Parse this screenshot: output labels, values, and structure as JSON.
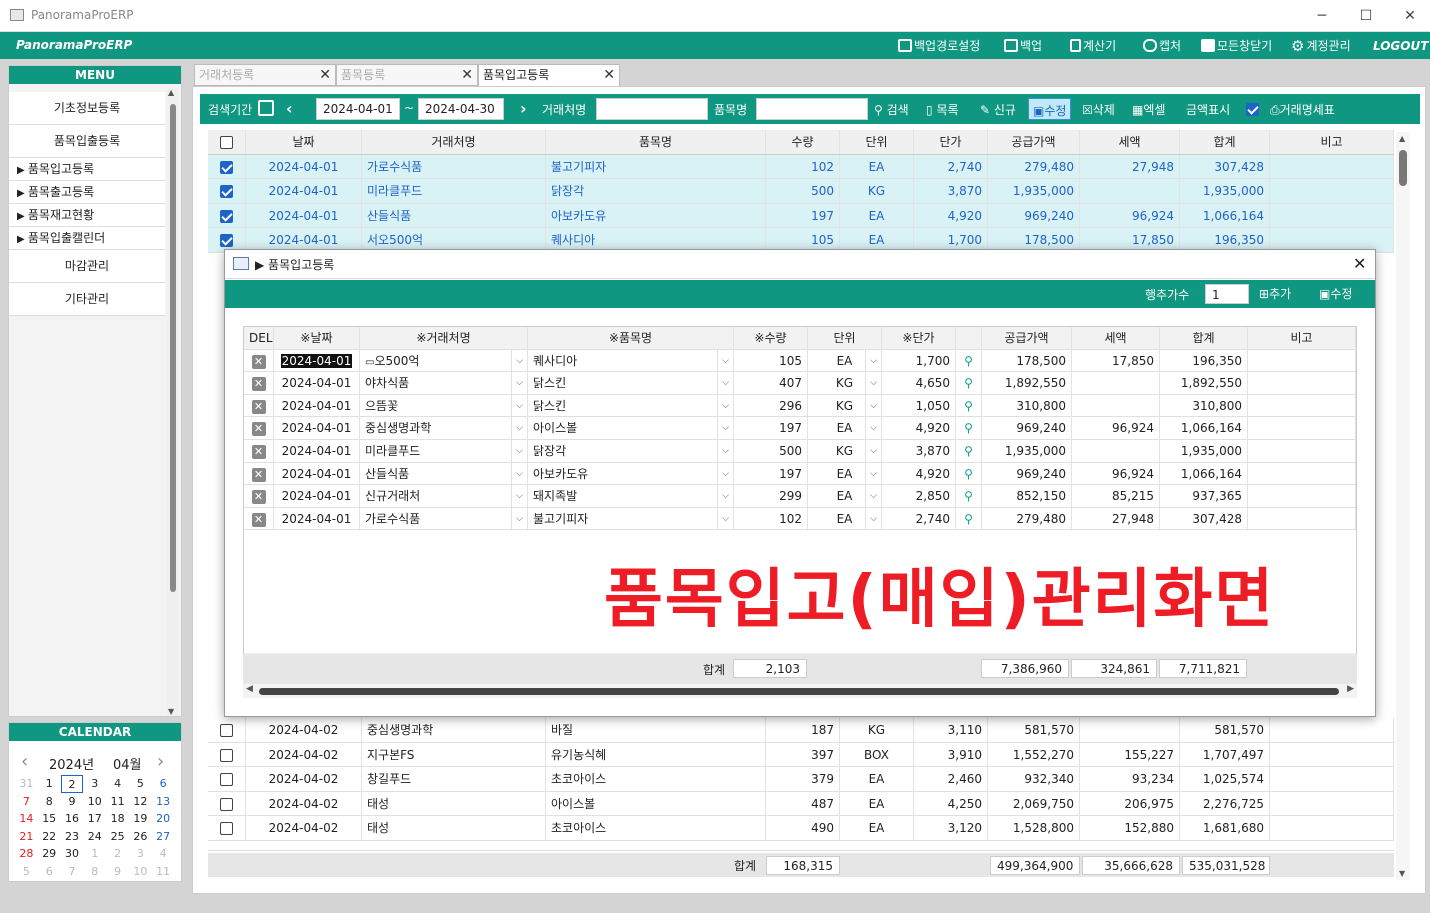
{
  "window": {
    "title": "PanoramaProERP",
    "min": "─",
    "max": "☐",
    "close": "✕"
  },
  "appbar": {
    "brand": "PanoramaProERP",
    "tools": [
      {
        "label": "백업경로설정",
        "icon": "save-icon"
      },
      {
        "label": "백업",
        "icon": "save-icon"
      },
      {
        "label": "계산기",
        "icon": "calculator-icon"
      },
      {
        "label": "캡처",
        "icon": "capture-icon"
      },
      {
        "label": "모든창닫기",
        "icon": "close-all-icon"
      },
      {
        "label": "계정관리",
        "icon": "gear-icon"
      }
    ],
    "logout": "LOGOUT"
  },
  "sidebar": {
    "title": "MENU",
    "items": [
      {
        "label": "기초정보등록",
        "tree": false
      },
      {
        "label": "품목입출등록",
        "tree": false
      },
      {
        "label": "품목입고등록",
        "tree": true
      },
      {
        "label": "품목출고등록",
        "tree": true
      },
      {
        "label": "품목재고현황",
        "tree": true
      },
      {
        "label": "품목입출캘린더",
        "tree": true
      },
      {
        "label": "마감관리",
        "tree": false
      },
      {
        "label": "기타관리",
        "tree": false
      }
    ]
  },
  "calendar": {
    "title": "CALENDAR",
    "year": "2024년",
    "month": "04월",
    "weeks": [
      [
        "31",
        "1",
        "2",
        "3",
        "4",
        "5",
        "6"
      ],
      [
        "7",
        "8",
        "9",
        "10",
        "11",
        "12",
        "13"
      ],
      [
        "14",
        "15",
        "16",
        "17",
        "18",
        "19",
        "20"
      ],
      [
        "21",
        "22",
        "23",
        "24",
        "25",
        "26",
        "27"
      ],
      [
        "28",
        "29",
        "30",
        "1",
        "2",
        "3",
        "4"
      ],
      [
        "5",
        "6",
        "7",
        "8",
        "9",
        "10",
        "11"
      ]
    ]
  },
  "tabs": [
    {
      "label": "거래처등록",
      "active": false
    },
    {
      "label": "품목등록",
      "active": false
    },
    {
      "label": "품목입고등록",
      "active": true
    }
  ],
  "search": {
    "period_label": "검색기간",
    "date_from": "2024-04-01",
    "tilde": "~",
    "date_to": "2024-04-30",
    "customer_label": "거래처명",
    "customer_value": "",
    "item_label": "품목명",
    "item_value": "",
    "buttons": [
      "검색",
      "목록",
      "신규",
      "수정",
      "삭제",
      "엑셀",
      "금액표시",
      "거래명세표"
    ]
  },
  "grid": {
    "headers": [
      "",
      "날짜",
      "거래처명",
      "품목명",
      "수량",
      "단위",
      "단가",
      "공급가액",
      "세액",
      "합계",
      "비고"
    ],
    "top_rows": [
      {
        "checked": true,
        "date": "2024-04-01",
        "customer": "가로수식품",
        "item": "불고기피자",
        "qty": "102",
        "unit": "EA",
        "price": "2,740",
        "supply": "279,480",
        "tax": "27,948",
        "total": "307,428",
        "note": ""
      },
      {
        "checked": true,
        "date": "2024-04-01",
        "customer": "미라클푸드",
        "item": "닭장각",
        "qty": "500",
        "unit": "KG",
        "price": "3,870",
        "supply": "1,935,000",
        "tax": "",
        "total": "1,935,000",
        "note": ""
      },
      {
        "checked": true,
        "date": "2024-04-01",
        "customer": "산들식품",
        "item": "아보카도유",
        "qty": "197",
        "unit": "EA",
        "price": "4,920",
        "supply": "969,240",
        "tax": "96,924",
        "total": "1,066,164",
        "note": ""
      },
      {
        "checked": true,
        "date": "2024-04-01",
        "customer": "서오500억",
        "item": "퀘사디아",
        "qty": "105",
        "unit": "EA",
        "price": "1,700",
        "supply": "178,500",
        "tax": "17,850",
        "total": "196,350",
        "note": ""
      }
    ],
    "bottom_rows": [
      {
        "checked": false,
        "date": "2024-04-02",
        "customer": "중심생명과학",
        "item": "바질",
        "qty": "187",
        "unit": "KG",
        "price": "3,110",
        "supply": "581,570",
        "tax": "",
        "total": "581,570",
        "note": ""
      },
      {
        "checked": false,
        "date": "2024-04-02",
        "customer": "지구본FS",
        "item": "유기농식혜",
        "qty": "397",
        "unit": "BOX",
        "price": "3,910",
        "supply": "1,552,270",
        "tax": "155,227",
        "total": "1,707,497",
        "note": ""
      },
      {
        "checked": false,
        "date": "2024-04-02",
        "customer": "창길푸드",
        "item": "초코아이스",
        "qty": "379",
        "unit": "EA",
        "price": "2,460",
        "supply": "932,340",
        "tax": "93,234",
        "total": "1,025,574",
        "note": ""
      },
      {
        "checked": false,
        "date": "2024-04-02",
        "customer": "태성",
        "item": "아이스볼",
        "qty": "487",
        "unit": "EA",
        "price": "4,250",
        "supply": "2,069,750",
        "tax": "206,975",
        "total": "2,276,725",
        "note": ""
      },
      {
        "checked": false,
        "date": "2024-04-02",
        "customer": "태성",
        "item": "초코아이스",
        "qty": "490",
        "unit": "EA",
        "price": "3,120",
        "supply": "1,528,800",
        "tax": "152,880",
        "total": "1,681,680",
        "note": ""
      }
    ],
    "sum_label": "합계",
    "sum_qty": "168,315",
    "sum_supply": "499,364,900",
    "sum_tax": "35,666,628",
    "sum_total": "535,031,528"
  },
  "modal": {
    "title": "품목입고등록",
    "close": "✕",
    "row_add_label": "행추가수",
    "row_add_value": "1",
    "add_button": "추가",
    "edit_button": "수정",
    "headers": [
      "DEL",
      "※날짜",
      "※거래처명",
      "※품목명",
      "※수량",
      "단위",
      "※단가",
      "공급가액",
      "세액",
      "합계",
      "비고"
    ],
    "rows": [
      {
        "date": "2024-04-01",
        "customer": "오500억",
        "item": "퀘사디아",
        "qty": "105",
        "unit": "EA",
        "price": "1,700",
        "supply": "178,500",
        "tax": "17,850",
        "total": "196,350",
        "note": ""
      },
      {
        "date": "2024-04-01",
        "customer": "야차식품",
        "item": "닭스킨",
        "qty": "407",
        "unit": "KG",
        "price": "4,650",
        "supply": "1,892,550",
        "tax": "",
        "total": "1,892,550",
        "note": ""
      },
      {
        "date": "2024-04-01",
        "customer": "으뜸꽃",
        "item": "닭스킨",
        "qty": "296",
        "unit": "KG",
        "price": "1,050",
        "supply": "310,800",
        "tax": "",
        "total": "310,800",
        "note": ""
      },
      {
        "date": "2024-04-01",
        "customer": "중심생명과학",
        "item": "아이스볼",
        "qty": "197",
        "unit": "EA",
        "price": "4,920",
        "supply": "969,240",
        "tax": "96,924",
        "total": "1,066,164",
        "note": ""
      },
      {
        "date": "2024-04-01",
        "customer": "미라클푸드",
        "item": "닭장각",
        "qty": "500",
        "unit": "KG",
        "price": "3,870",
        "supply": "1,935,000",
        "tax": "",
        "total": "1,935,000",
        "note": ""
      },
      {
        "date": "2024-04-01",
        "customer": "산들식품",
        "item": "아보카도유",
        "qty": "197",
        "unit": "EA",
        "price": "4,920",
        "supply": "969,240",
        "tax": "96,924",
        "total": "1,066,164",
        "note": ""
      },
      {
        "date": "2024-04-01",
        "customer": "신규거래처",
        "item": "돼지족발",
        "qty": "299",
        "unit": "EA",
        "price": "2,850",
        "supply": "852,150",
        "tax": "85,215",
        "total": "937,365",
        "note": ""
      },
      {
        "date": "2024-04-01",
        "customer": "가로수식품",
        "item": "불고기피자",
        "qty": "102",
        "unit": "EA",
        "price": "2,740",
        "supply": "279,480",
        "tax": "27,948",
        "total": "307,428",
        "note": ""
      }
    ],
    "sum_label": "합계",
    "sum_qty": "2,103",
    "sum_supply": "7,386,960",
    "sum_tax": "324,861",
    "sum_total": "7,711,821"
  },
  "overlay_text": "품목입고(매입)관리화면"
}
